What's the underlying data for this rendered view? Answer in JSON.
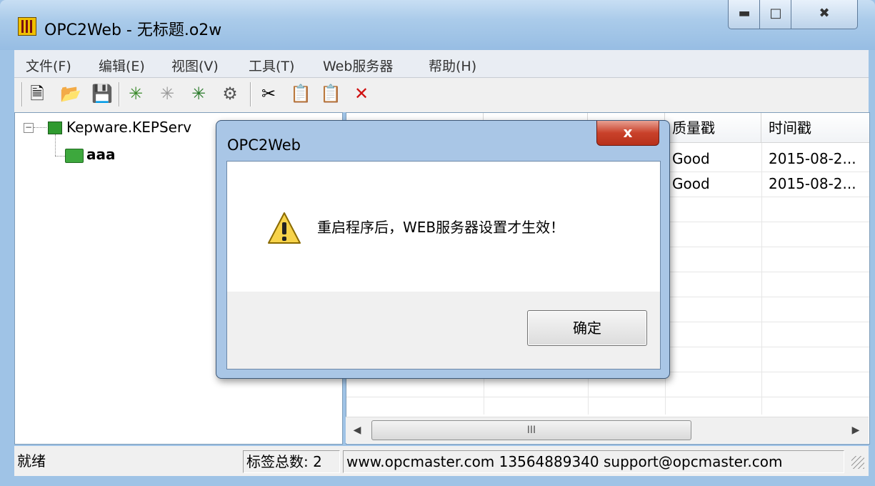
{
  "window": {
    "title": "OPC2Web - 无标题.o2w",
    "caption_buttons": [
      "minimize",
      "maximize",
      "close"
    ]
  },
  "menu": [
    "文件(F)",
    "编辑(E)",
    "视图(V)",
    "工具(T)",
    "Web服务器",
    "帮助(H)"
  ],
  "toolbar": {
    "icons": [
      "new-file-icon",
      "open-folder-icon",
      "save-icon",
      "add-server-icon",
      "add-group-icon",
      "add-item-icon",
      "properties-icon",
      "cut-icon",
      "copy-icon",
      "paste-icon",
      "delete-icon"
    ]
  },
  "tree": {
    "root": "Kepware.KEPServ",
    "child": "aaa"
  },
  "list": {
    "headers": [
      "",
      "",
      "",
      "质量戳",
      "时间戳"
    ],
    "rows": [
      {
        "quality": "Good",
        "time": "2015-08-2..."
      },
      {
        "quality": "Good",
        "time": "2015-08-2..."
      }
    ]
  },
  "status": {
    "ready": "就绪",
    "tag_count": "标签总数: 2",
    "contact": "www.opcmaster.com 13564889340 support@opcmaster.com"
  },
  "dialog": {
    "title": "OPC2Web",
    "close_glyph": "x",
    "message": "重启程序后，WEB服务器设置才生效！",
    "ok_label": "确定",
    "icon": "warning-icon"
  },
  "scrollbar": {
    "thumb_glyph": "III"
  }
}
